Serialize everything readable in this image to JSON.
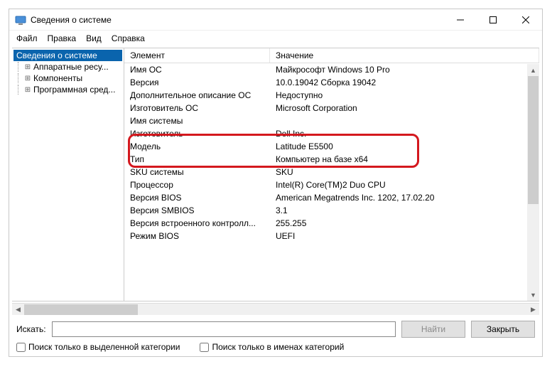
{
  "window": {
    "title": "Сведения о системе"
  },
  "menu": {
    "file": "Файл",
    "edit": "Правка",
    "view": "Вид",
    "help": "Справка"
  },
  "tree": {
    "root": "Сведения о системе",
    "hardware": "Аппаратные ресу...",
    "components": "Компоненты",
    "software": "Программная сред..."
  },
  "columns": {
    "element": "Элемент",
    "value": "Значение"
  },
  "rows": [
    {
      "k": "Имя ОС",
      "v": "Майкрософт Windows 10 Pro"
    },
    {
      "k": "Версия",
      "v": "10.0.19042 Сборка 19042"
    },
    {
      "k": "Дополнительное описание ОС",
      "v": "Недоступно"
    },
    {
      "k": "Изготовитель ОС",
      "v": "Microsoft Corporation"
    },
    {
      "k": "Имя системы",
      "v": ""
    },
    {
      "k": "Изготовитель",
      "v": "Dell Inc."
    },
    {
      "k": "Модель",
      "v": "Latitude E5500"
    },
    {
      "k": "Тип",
      "v": "Компьютер на базе x64"
    },
    {
      "k": "SKU системы",
      "v": "SKU"
    },
    {
      "k": "Процессор",
      "v": "Intel(R) Core(TM)2 Duo CPU"
    },
    {
      "k": "Версия BIOS",
      "v": "American Megatrends Inc. 1202, 17.02.20"
    },
    {
      "k": "Версия SMBIOS",
      "v": "3.1"
    },
    {
      "k": "Версия встроенного контролл...",
      "v": "255.255"
    },
    {
      "k": "Режим BIOS",
      "v": "UEFI"
    }
  ],
  "search": {
    "label": "Искать:",
    "find": "Найти",
    "close": "Закрыть",
    "only_category": "Поиск только в выделенной категории",
    "only_names": "Поиск только в именах категорий"
  }
}
